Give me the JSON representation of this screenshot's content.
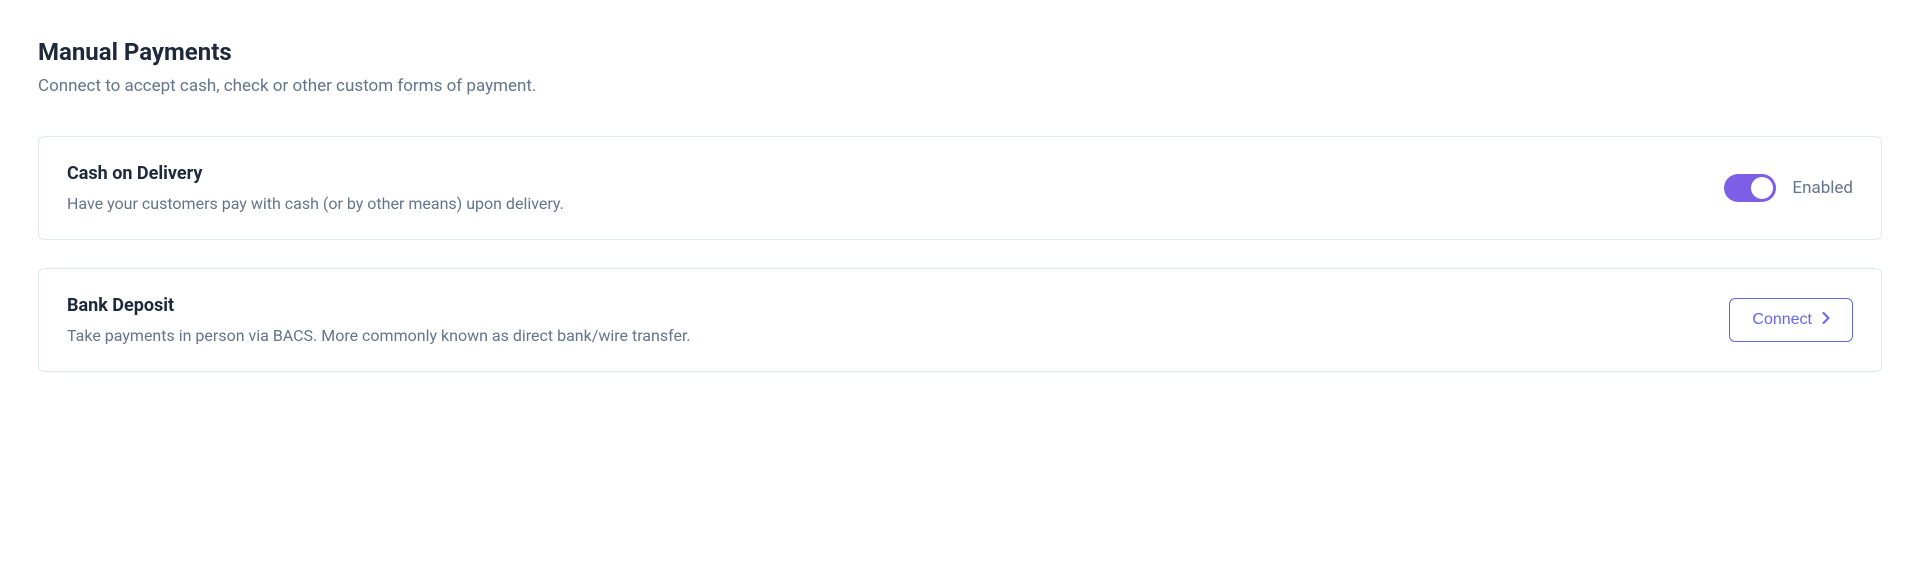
{
  "section": {
    "title": "Manual Payments",
    "subtitle": "Connect to accept cash, check or other custom forms of payment."
  },
  "methods": [
    {
      "title": "Cash on Delivery",
      "description": "Have your customers pay with cash (or by other means) upon delivery.",
      "enabled": true,
      "status_label": "Enabled"
    },
    {
      "title": "Bank Deposit",
      "description": "Take payments in person via BACS. More commonly known as direct bank/wire transfer.",
      "enabled": false,
      "action_label": "Connect"
    }
  ]
}
